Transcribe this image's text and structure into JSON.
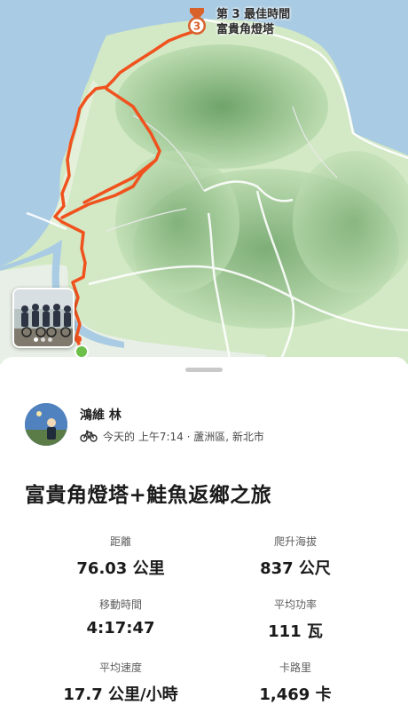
{
  "map": {
    "award": {
      "line1": "第 3 最佳時間",
      "line2": "富貴角燈塔",
      "rank": "3"
    },
    "colors": {
      "route": "#f0521e",
      "sea": "#a9cbe3",
      "land": "#cfe6c2",
      "mountain": "#8fbb85"
    }
  },
  "activity": {
    "athlete_name": "鴻維 林",
    "meta": "今天的 上午7:14 · 蘆洲區, 新北市",
    "title": "富貴角燈塔+鮭魚返鄉之旅",
    "stats": [
      {
        "label": "距離",
        "value": "76.03 公里"
      },
      {
        "label": "爬升海拔",
        "value": "837 公尺"
      },
      {
        "label": "移動時間",
        "value": "4:17:47"
      },
      {
        "label": "平均功率",
        "value": "111 瓦"
      },
      {
        "label": "平均速度",
        "value": "17.7 公里/小時"
      },
      {
        "label": "卡路里",
        "value": "1,469 卡"
      }
    ]
  }
}
